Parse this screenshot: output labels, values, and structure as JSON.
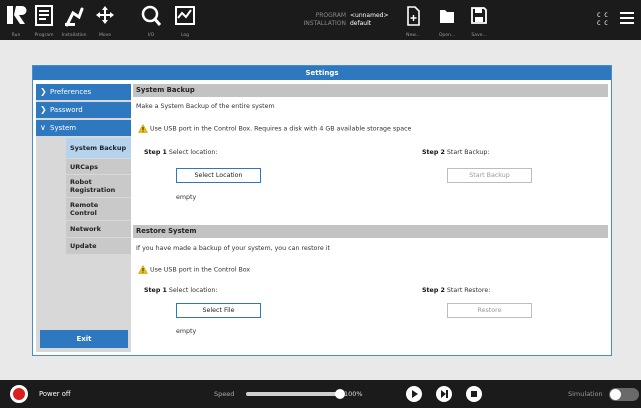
{
  "header": {
    "nav": [
      {
        "label": "Run",
        "icon": "ur-logo-icon"
      },
      {
        "label": "Program",
        "icon": "program-icon"
      },
      {
        "label": "Installation",
        "icon": "installation-icon"
      },
      {
        "label": "Move",
        "icon": "move-icon"
      },
      {
        "label": "I/O",
        "icon": "io-icon"
      },
      {
        "label": "Log",
        "icon": "log-icon"
      }
    ],
    "program_key": "PROGRAM",
    "program_value": "<unnamed>",
    "installation_key": "INSTALLATION",
    "installation_value": "default",
    "file_actions": [
      {
        "label": "New...",
        "icon": "new-file-icon"
      },
      {
        "label": "Open...",
        "icon": "open-folder-icon"
      },
      {
        "label": "Save...",
        "icon": "save-icon"
      }
    ],
    "cc_line1": "C C",
    "cc_line2": "C C"
  },
  "settings": {
    "title": "Settings",
    "sidebar": [
      {
        "label": "Preferences",
        "chevron": "right"
      },
      {
        "label": "Password",
        "chevron": "right"
      },
      {
        "label": "System",
        "chevron": "down"
      }
    ],
    "subitems": [
      "System Backup",
      "URCaps",
      "Robot Registration",
      "Remote Control",
      "Network",
      "Update"
    ],
    "active_subitem": "System Backup",
    "exit_label": "Exit",
    "backup": {
      "heading": "System Backup",
      "description": "Make a System Backup of the entire system",
      "warning": "Use USB port in the Control Box. Requires a disk with 4 GB available storage space",
      "step1_label": "Step 1",
      "step1_text": "Select location:",
      "step2_label": "Step 2",
      "step2_text": "Start Backup:",
      "select_button": "Select Location",
      "start_button": "Start Backup",
      "status": "empty"
    },
    "restore": {
      "heading": "Restore System",
      "description": "If you have made a backup of your system, you can restore it",
      "warning": "Use USB port in the Control Box",
      "step1_label": "Step 1",
      "step1_text": "Select location:",
      "step2_label": "Step 2",
      "step2_text": "Start Restore:",
      "select_button": "Select File",
      "restore_button": "Restore",
      "status": "empty"
    }
  },
  "footer": {
    "power_label": "Power off",
    "speed_label": "Speed",
    "speed_value": "100%",
    "speed_fraction": 1.0,
    "simulation_label": "Simulation"
  },
  "colors": {
    "accent": "#2e78c0",
    "topbar": "#1b1b1b",
    "power_red": "#d9201f",
    "warning_yellow": "#f2c200"
  }
}
